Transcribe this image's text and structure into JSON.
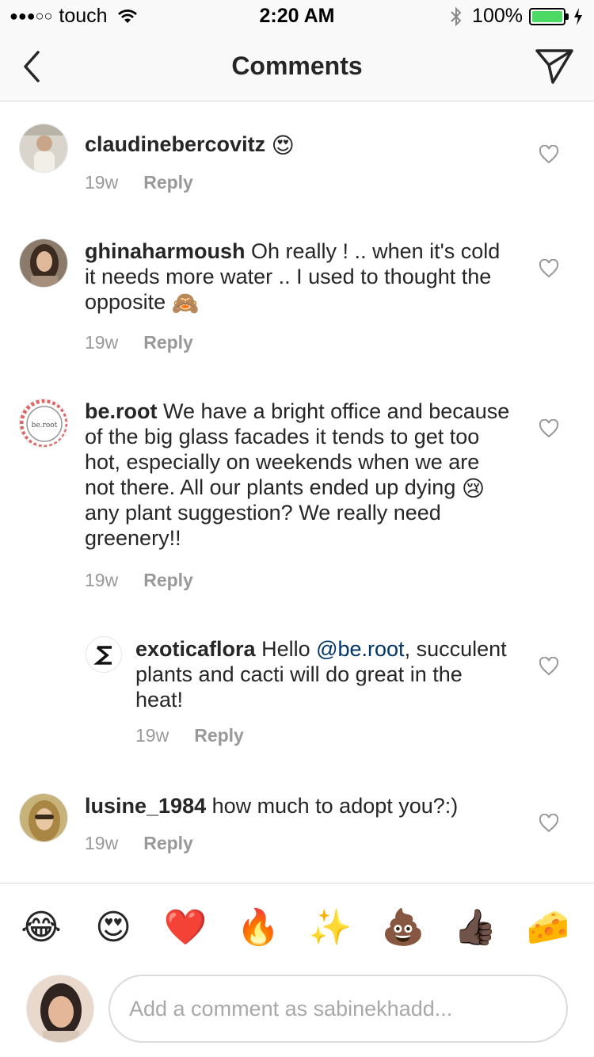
{
  "status_bar": {
    "signal": "●●●○○",
    "carrier": "touch",
    "time": "2:20 AM",
    "battery": "100%",
    "battery_level": 1.0
  },
  "nav": {
    "title": "Comments",
    "back_icon": "chevron-left-icon",
    "send_icon": "paper-plane-icon"
  },
  "comments": [
    {
      "username": "claudinebercovitz",
      "text": "",
      "emoji": "😍",
      "age": "19w",
      "reply_label": "Reply"
    },
    {
      "username": "ghinaharmoush",
      "text": " Oh really ! .. when it's cold it needs more water .. I used to thought the opposite ",
      "emoji": "🙈",
      "age": "19w",
      "reply_label": "Reply"
    },
    {
      "username": "be.root",
      "text_before": " We have a bright office and because of the big glass facades it tends to get too hot, especially on weekends when we are not there. All our plants ended up dying ",
      "emoji": "😢",
      "text_after": "  any plant suggestion? We really need greenery!!",
      "age": "19w",
      "reply_label": "Reply"
    },
    {
      "username": "exoticaflora",
      "text_before": " Hello ",
      "mention": "@be.root",
      "text_after": ", succulent plants and cacti will do great in the heat!",
      "age": "19w",
      "reply_label": "Reply"
    },
    {
      "username": "lusine_1984",
      "text": " how much to adopt you?:)",
      "age": "19w",
      "reply_label": "Reply"
    }
  ],
  "emoji_bar": [
    "😂",
    "😍",
    "❤️",
    "🔥",
    "✨",
    "💩",
    "👍🏿",
    "🧀"
  ],
  "composer": {
    "placeholder": "Add a comment as sabinekhadd..."
  },
  "colors": {
    "accent_mention": "#003569",
    "meta_gray": "#999999",
    "battery_green": "#4cd964"
  }
}
